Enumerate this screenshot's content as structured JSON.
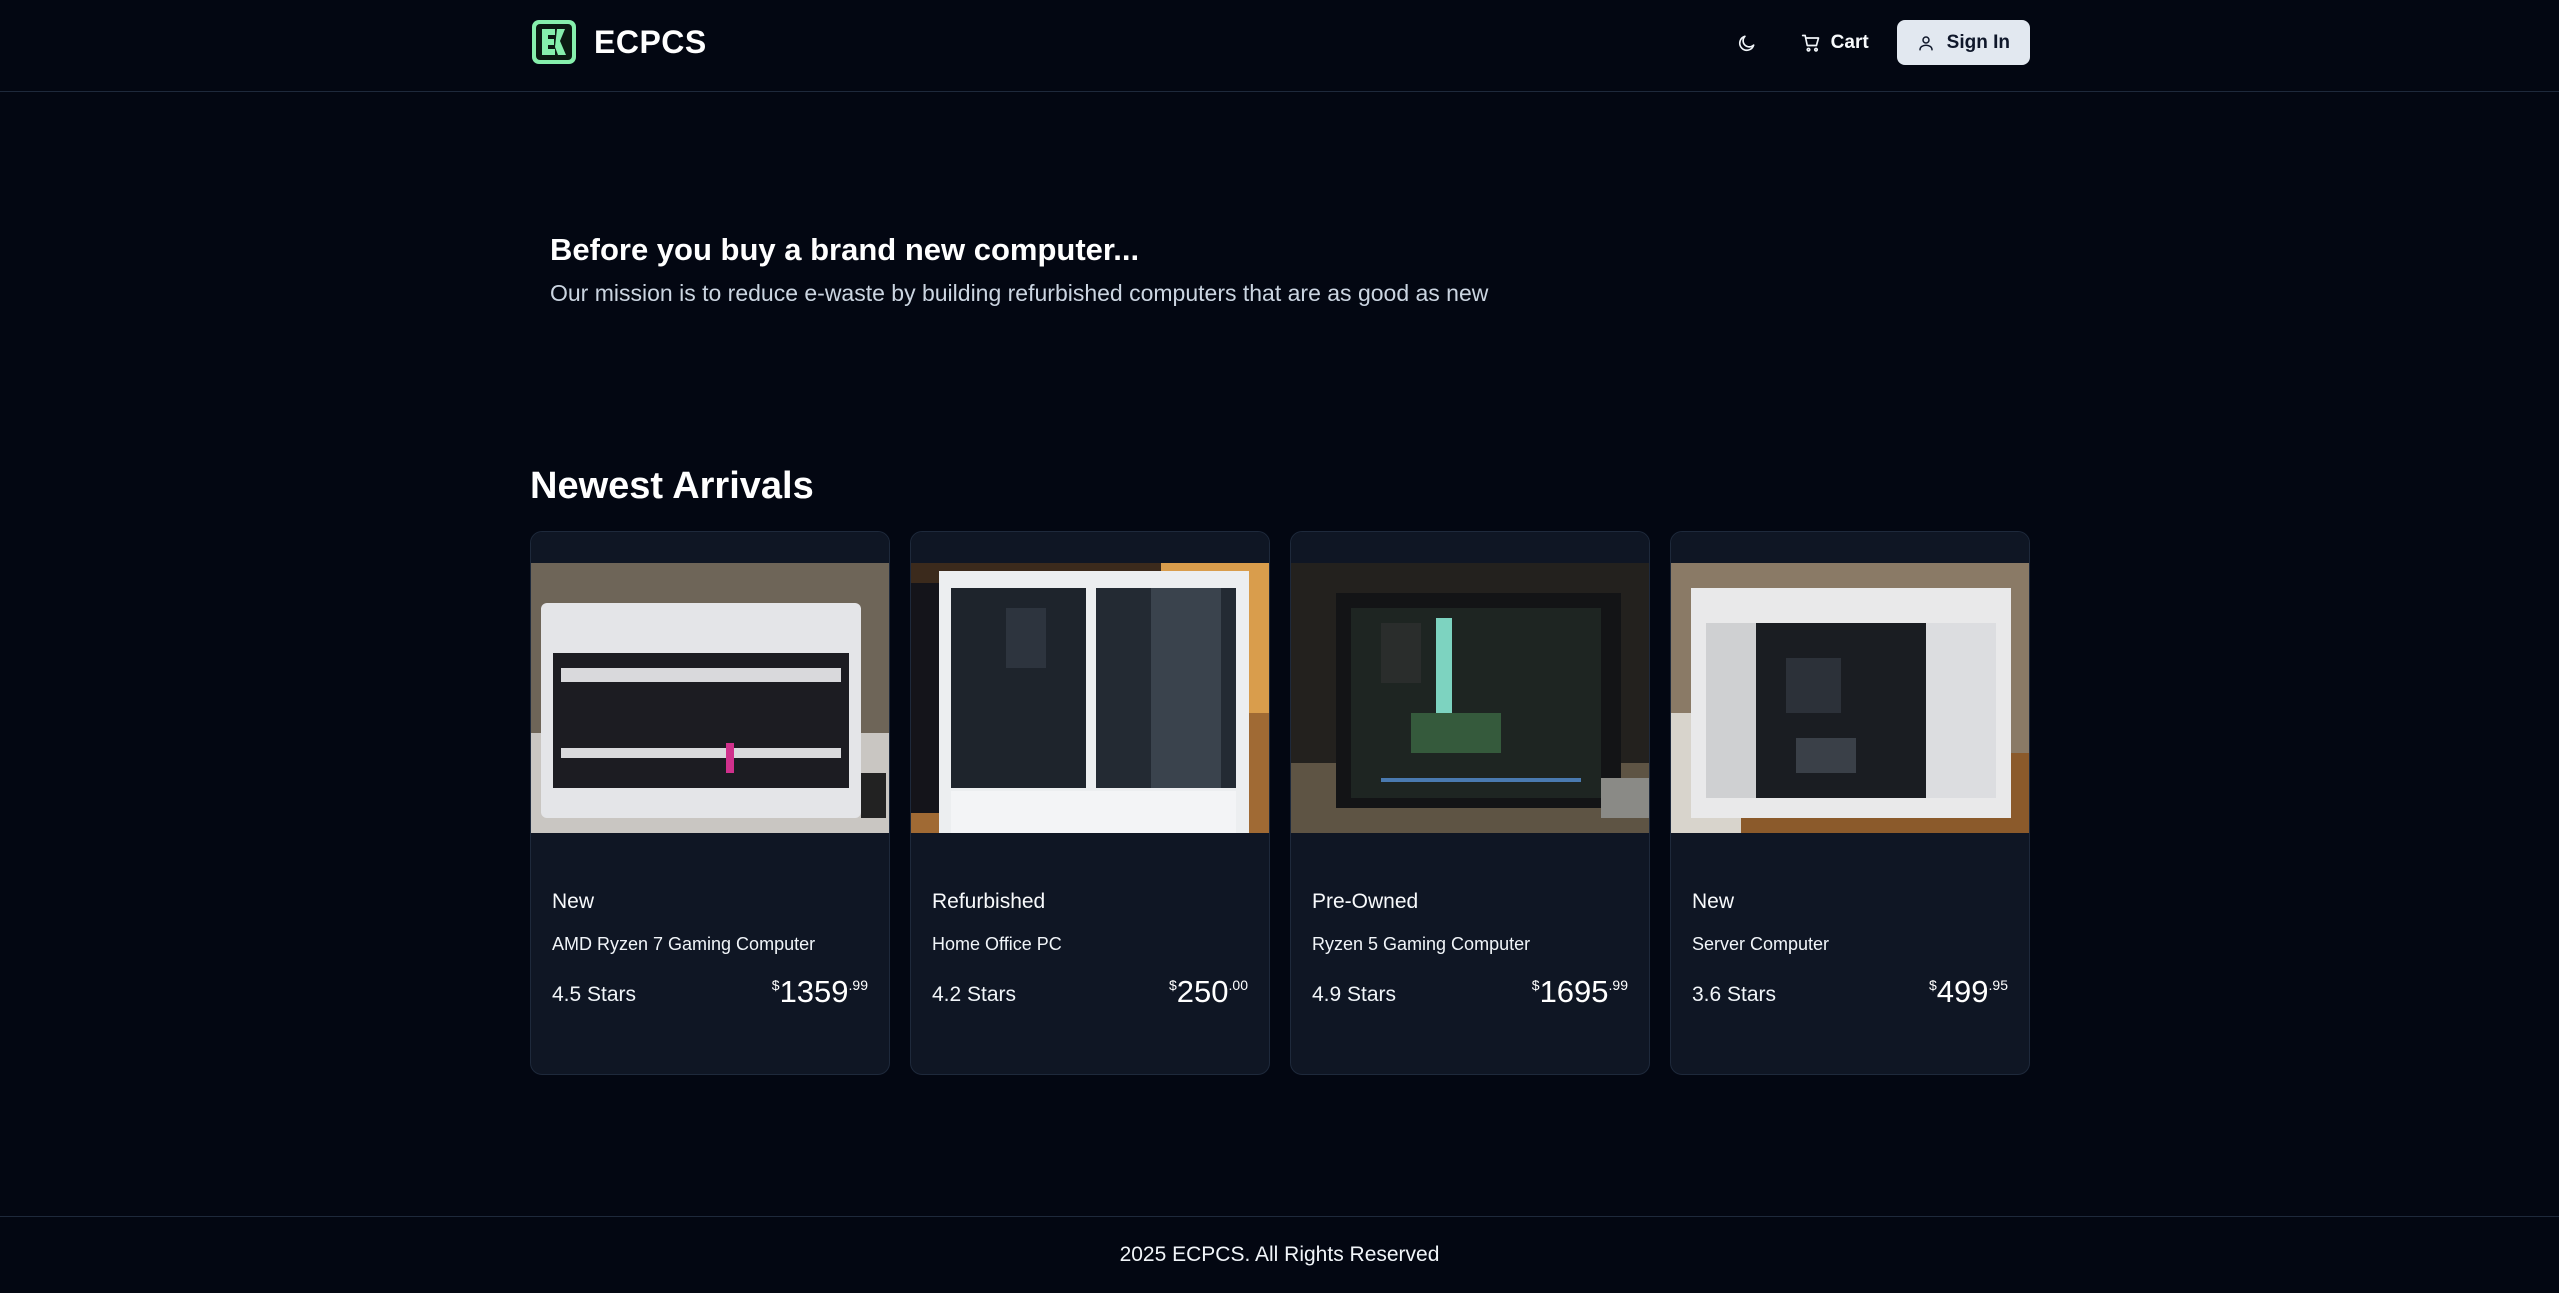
{
  "header": {
    "brand_name": "ECPCS",
    "logo_icon": "ec-logo-icon",
    "theme_icon": "moon-icon",
    "cart_label": "Cart",
    "cart_icon": "cart-icon",
    "signin_label": "Sign In",
    "signin_icon": "user-icon"
  },
  "hero": {
    "title": "Before you buy a brand new computer...",
    "subtitle": "Our mission is to reduce e-waste by building refurbished computers that are as good as new"
  },
  "section": {
    "title": "Newest Arrivals"
  },
  "products": [
    {
      "condition": "New",
      "name": "AMD Ryzen 7 Gaming Computer",
      "rating": "4.5 Stars",
      "currency": "$",
      "price_whole": "1359",
      "price_cents": ".99"
    },
    {
      "condition": "Refurbished",
      "name": "Home Office PC",
      "rating": "4.2 Stars",
      "currency": "$",
      "price_whole": "250",
      "price_cents": ".00"
    },
    {
      "condition": "Pre-Owned",
      "name": "Ryzen 5 Gaming Computer",
      "rating": "4.9 Stars",
      "currency": "$",
      "price_whole": "1695",
      "price_cents": ".99"
    },
    {
      "condition": "New",
      "name": "Server Computer",
      "rating": "3.6 Stars",
      "currency": "$",
      "price_whole": "499",
      "price_cents": ".95"
    }
  ],
  "footer": {
    "text": "2025 ECPCS. All Rights Reserved"
  },
  "colors": {
    "background": "#030712",
    "card": "#0f1624",
    "border": "#1e293b",
    "logo_green": "#86efac"
  }
}
